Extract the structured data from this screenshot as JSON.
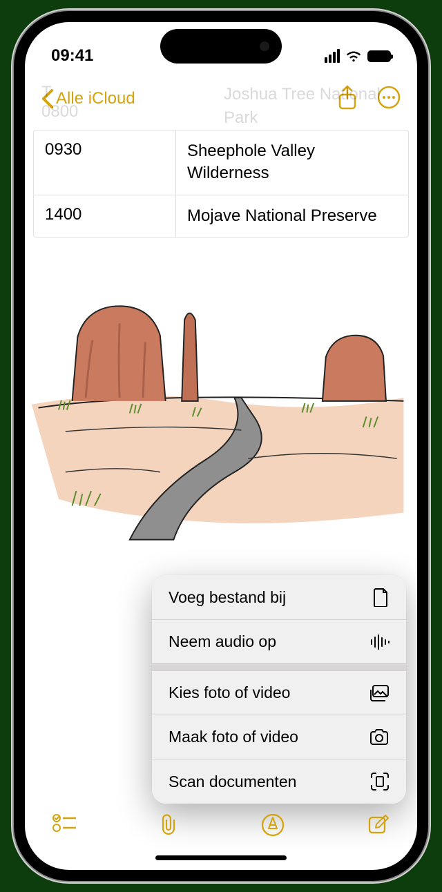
{
  "statusbar": {
    "time": "09:41"
  },
  "nav": {
    "back_label": "Alle iCloud"
  },
  "obscured": {
    "top_left": "T",
    "top_left2": "0800",
    "top_right": "Joshua Tree National\nPark"
  },
  "table": {
    "rows": [
      {
        "time": "0930",
        "place": "Sheephole Valley Wilderness"
      },
      {
        "time": "1400",
        "place": "Mojave National Preserve"
      }
    ]
  },
  "menu": {
    "attach_file": "Voeg bestand bij",
    "record_audio": "Neem audio op",
    "choose_photo": "Kies foto of video",
    "take_photo": "Maak foto of video",
    "scan_docs": "Scan documenten"
  }
}
